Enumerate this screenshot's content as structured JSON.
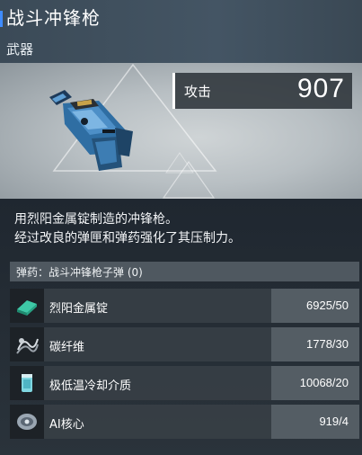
{
  "item": {
    "title": "战斗冲锋枪",
    "category": "武器"
  },
  "stat": {
    "label": "攻击",
    "value": "907"
  },
  "description": {
    "line1": "用烈阳金属锭制造的冲锋枪。",
    "line2": "经过改良的弹匣和弹药强化了其压制力。"
  },
  "ammo": {
    "text": "弹药：战斗冲锋枪子弹 (0)"
  },
  "materials": [
    {
      "name": "烈阳金属锭",
      "count": "6925/50",
      "icon": "metal-ingot-icon"
    },
    {
      "name": "碳纤维",
      "count": "1778/30",
      "icon": "carbon-fiber-icon"
    },
    {
      "name": "极低温冷却介质",
      "count": "10068/20",
      "icon": "coolant-canister-icon"
    },
    {
      "name": "AI核心",
      "count": "919/4",
      "icon": "ai-core-icon"
    }
  ],
  "colors": {
    "accent_blue": "#3f8cff",
    "header_bg": "#445564",
    "panel_bg": "#242c34"
  }
}
